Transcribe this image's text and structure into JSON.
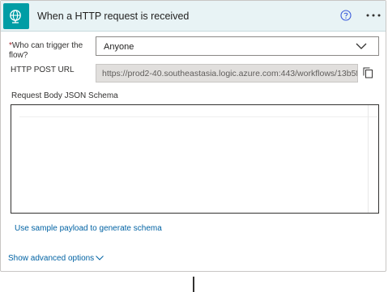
{
  "card": {
    "title": "When a HTTP request is received",
    "icon": "globe-trigger-icon",
    "accent": "#009da5",
    "header_bg": "#e8f3f5"
  },
  "fields": {
    "who_label_star": "*",
    "who_label": "Who can trigger the flow?",
    "who_value": "Anyone",
    "url_label": "HTTP POST URL",
    "url_value": "https://prod2-40.southeastasia.logic.azure.com:443/workflows/13b5f5d...",
    "schema_label": "Request Body JSON Schema",
    "schema_value": ""
  },
  "links": {
    "sample_payload": "Use sample payload to generate schema",
    "advanced": "Show advanced options"
  },
  "icons": [
    "help-icon",
    "more-options-icon",
    "chevron-down-icon",
    "copy-icon"
  ],
  "colors": {
    "link": "#0062a3",
    "required": "#a4262c",
    "disabled_field": "#e1dfdd"
  }
}
